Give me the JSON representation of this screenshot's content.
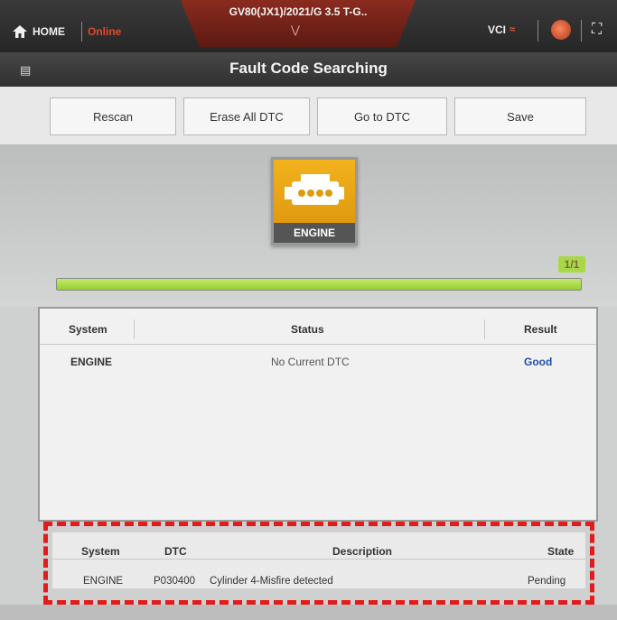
{
  "header": {
    "home_label": "HOME",
    "online_label": "Online",
    "vehicle": "GV80(JX1)/2021/G 3.5 T-G..",
    "vci_label": "VCI"
  },
  "titlebar": {
    "title": "Fault Code Searching"
  },
  "toolbar": {
    "buttons": [
      "Rescan",
      "Erase All DTC",
      "Go to DTC",
      "Save"
    ]
  },
  "module": {
    "label": "ENGINE",
    "progress_text": "1/1",
    "progress_fraction": 1.0
  },
  "system_table": {
    "headers": {
      "system": "System",
      "status": "Status",
      "result": "Result"
    },
    "rows": [
      {
        "system": "ENGINE",
        "status": "No Current DTC",
        "result": "Good"
      }
    ]
  },
  "dtc_table": {
    "headers": {
      "system": "System",
      "dtc": "DTC",
      "description": "Description",
      "state": "State"
    },
    "rows": [
      {
        "system": "ENGINE",
        "dtc": "P030400",
        "description": "Cylinder 4-Misfire detected",
        "state": "Pending"
      }
    ]
  },
  "colors": {
    "accent_online": "#e04a2a",
    "result_good": "#1f4fb0",
    "highlight_box": "#e21b1b",
    "progress_green": "#a8d84a",
    "engine_icon": "#f2b21e"
  }
}
